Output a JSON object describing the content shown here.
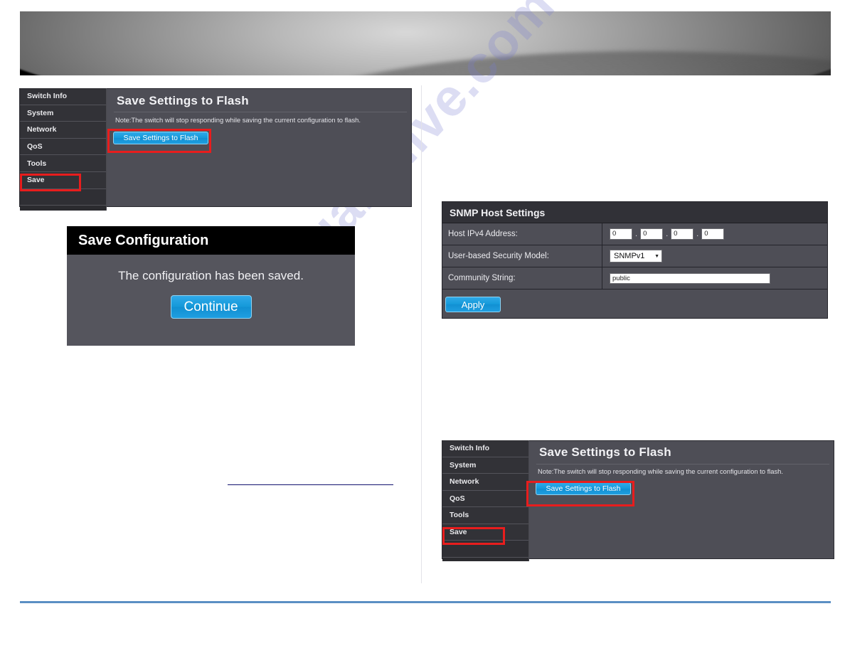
{
  "watermark": {
    "text": "manualshive.com"
  },
  "banner": {
    "label": "product-banner"
  },
  "panel_a": {
    "title": "Save Settings to Flash",
    "note": "Note:The switch will stop responding while saving the current configuration to flash.",
    "button": "Save Settings to Flash",
    "nav": [
      {
        "label": "Switch Info"
      },
      {
        "label": "System"
      },
      {
        "label": "Network"
      },
      {
        "label": "QoS"
      },
      {
        "label": "Tools"
      },
      {
        "label": "Save"
      }
    ]
  },
  "save_dialog": {
    "title": "Save Configuration",
    "message": "The configuration has been saved.",
    "continue_label": "Continue"
  },
  "panel_b": {
    "title": "SNMP Host Settings",
    "rows": [
      {
        "label": "Host IPv4 Address:"
      },
      {
        "label": "User-based Security Model:"
      },
      {
        "label": "Community String:"
      }
    ],
    "host_ipv4": {
      "octet1": "0",
      "octet2": "0",
      "octet3": "0",
      "octet4": "0",
      "separator": "."
    },
    "security_model": {
      "value": "SNMPv1",
      "caret": "▼"
    },
    "community_string": {
      "value": "public"
    },
    "apply_label": "Apply"
  },
  "panel_c": {
    "title": "Save Settings to Flash",
    "note": "Note:The switch will stop responding while saving the current configuration to flash.",
    "button": "Save Settings to Flash",
    "nav": [
      {
        "label": "Switch Info"
      },
      {
        "label": "System"
      },
      {
        "label": "Network"
      },
      {
        "label": "QoS"
      },
      {
        "label": "Tools"
      },
      {
        "label": "Save"
      }
    ]
  },
  "colors": {
    "accent_blue": "#159ada",
    "highlight_red": "#e81d1d",
    "panel_bg": "#4e4e56",
    "sidebar_bg": "#323237",
    "rule_blue": "#5b8fc4",
    "rule_navy": "#12126e"
  }
}
